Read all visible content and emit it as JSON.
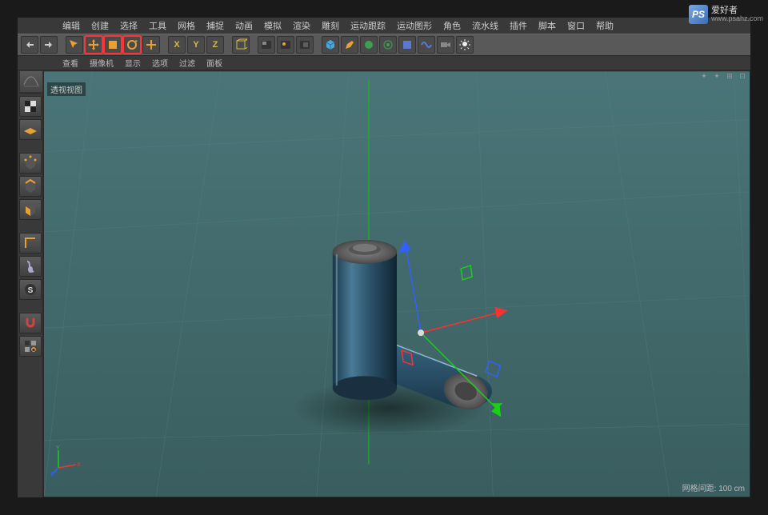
{
  "menu": [
    "编辑",
    "创建",
    "选择",
    "工具",
    "网格",
    "捕捉",
    "动画",
    "模拟",
    "渲染",
    "雕刻",
    "运动跟踪",
    "运动图形",
    "角色",
    "流水线",
    "插件",
    "脚本",
    "窗口",
    "帮助"
  ],
  "submenu": [
    "查看",
    "摄像机",
    "显示",
    "选项",
    "过滤",
    "面板"
  ],
  "axes": {
    "x": "X",
    "y": "Y",
    "z": "Z"
  },
  "viewport": {
    "label": "透视视图"
  },
  "status": {
    "grid": "网格间距: 100 cm"
  },
  "watermark": {
    "logo": "PS",
    "title": "爱好者",
    "url": "www.psahz.com"
  },
  "toolbar": {
    "undo": "undo",
    "redo": "redo",
    "live": "live",
    "move": "move",
    "scale": "scale",
    "rotate": "rotate",
    "last": "last",
    "cube": "cube",
    "clap": "clap",
    "render1": "r1",
    "render2": "r2",
    "render3": "r3",
    "prim": "prim",
    "pen": "pen",
    "def1": "d1",
    "def2": "d2",
    "def3": "d3",
    "def4": "d4",
    "cam": "cam",
    "light": "light"
  },
  "left": {
    "cube": "cube",
    "checker": "checker",
    "floor": "floor",
    "cube2": "cube2",
    "cube3": "cube3",
    "cube4": "cube4",
    "corner": "corner",
    "mouse": "mouse",
    "s": "S",
    "magnet": "magnet",
    "lock": "lock"
  },
  "vp_icons": {
    "a": "✦",
    "b": "✦",
    "c": "⊞",
    "d": "⊡"
  }
}
